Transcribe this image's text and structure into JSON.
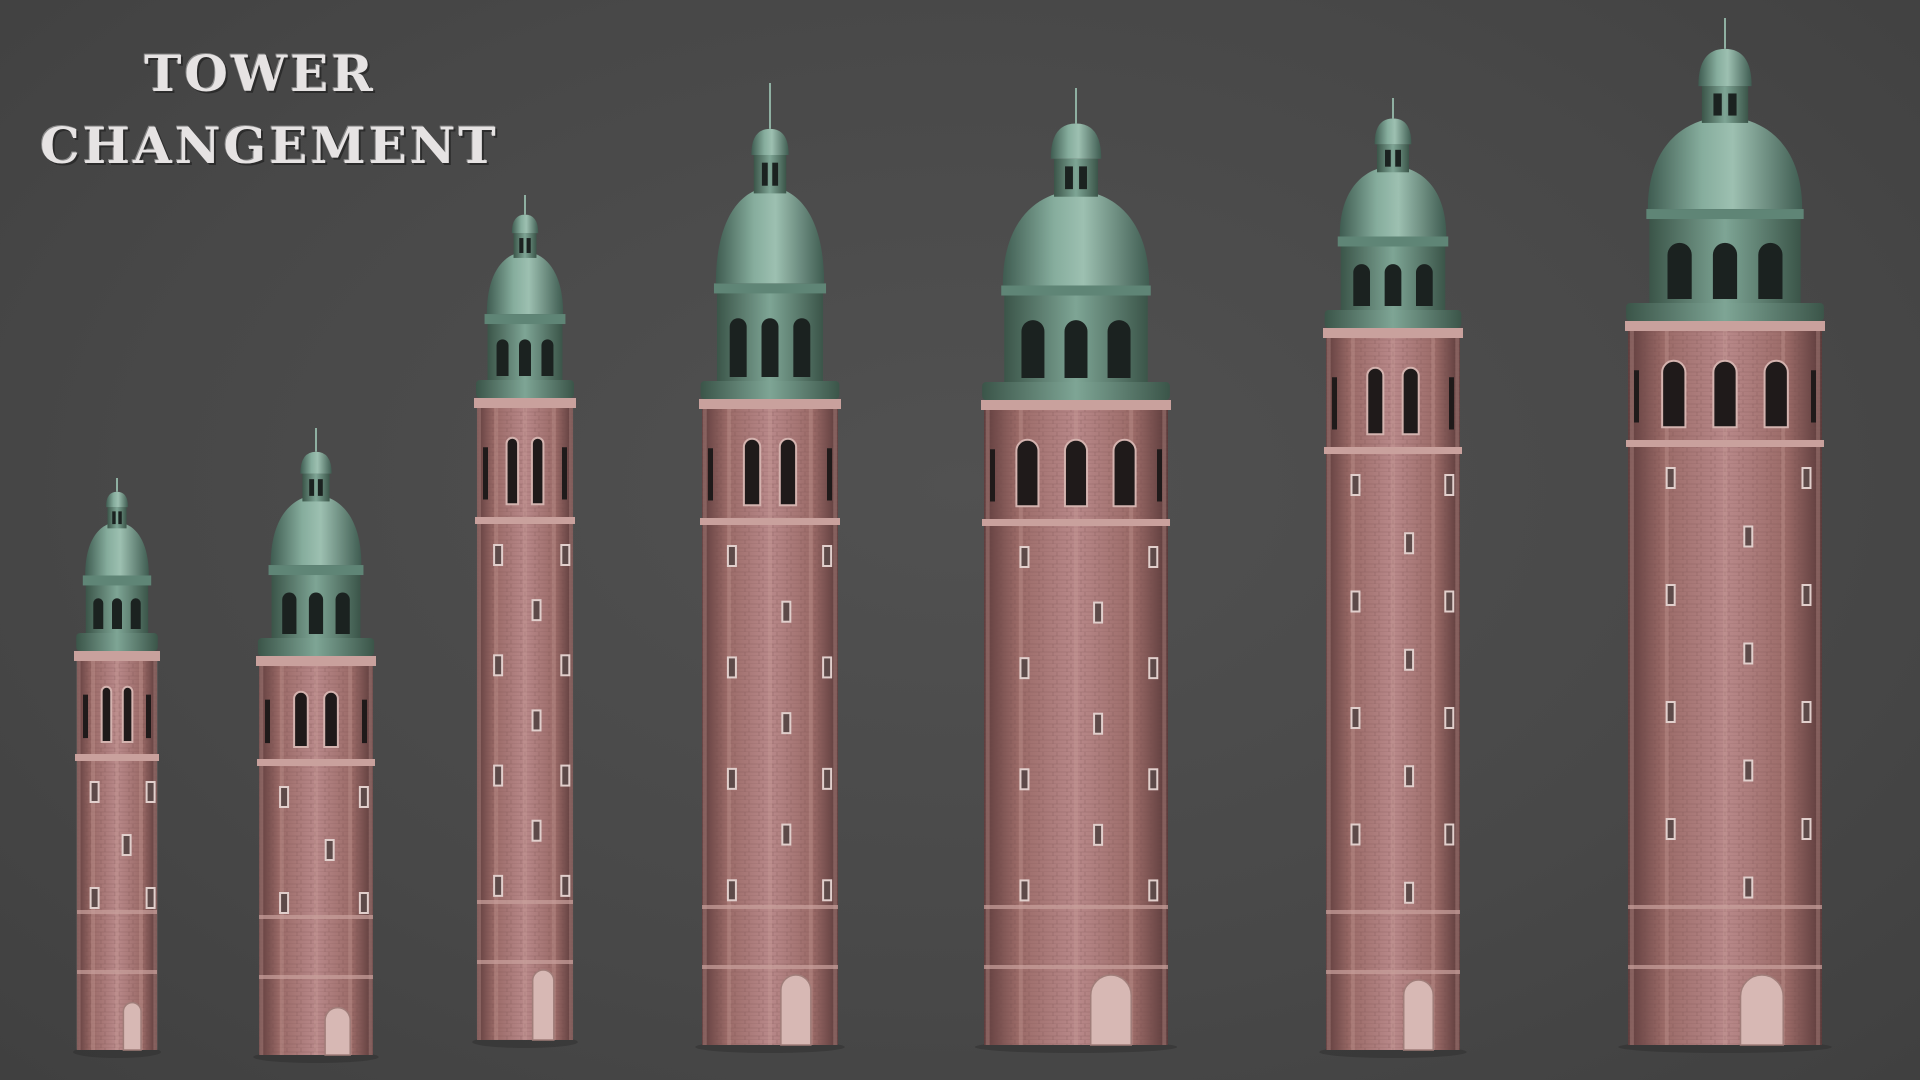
{
  "title": {
    "line1": "TOWER",
    "line2": "CHANGEMENT"
  },
  "colors": {
    "background": "#4a4a4a",
    "brick": "#a7736f",
    "brick_dark": "#7c5150",
    "brick_light": "#c0908b",
    "dome": "#6f9686",
    "dome_dark": "#4d6e61",
    "dome_light": "#9dc0b1",
    "window": "#1f1a1a",
    "frame": "#c9b3af"
  },
  "towers": [
    {
      "id": "tower-1",
      "levels": 2
    },
    {
      "id": "tower-2",
      "levels": 3
    },
    {
      "id": "tower-3",
      "levels": 5
    },
    {
      "id": "tower-4",
      "levels": 5
    },
    {
      "id": "tower-5",
      "levels": 5
    },
    {
      "id": "tower-6",
      "levels": 6
    },
    {
      "id": "tower-7",
      "levels": 6
    }
  ]
}
